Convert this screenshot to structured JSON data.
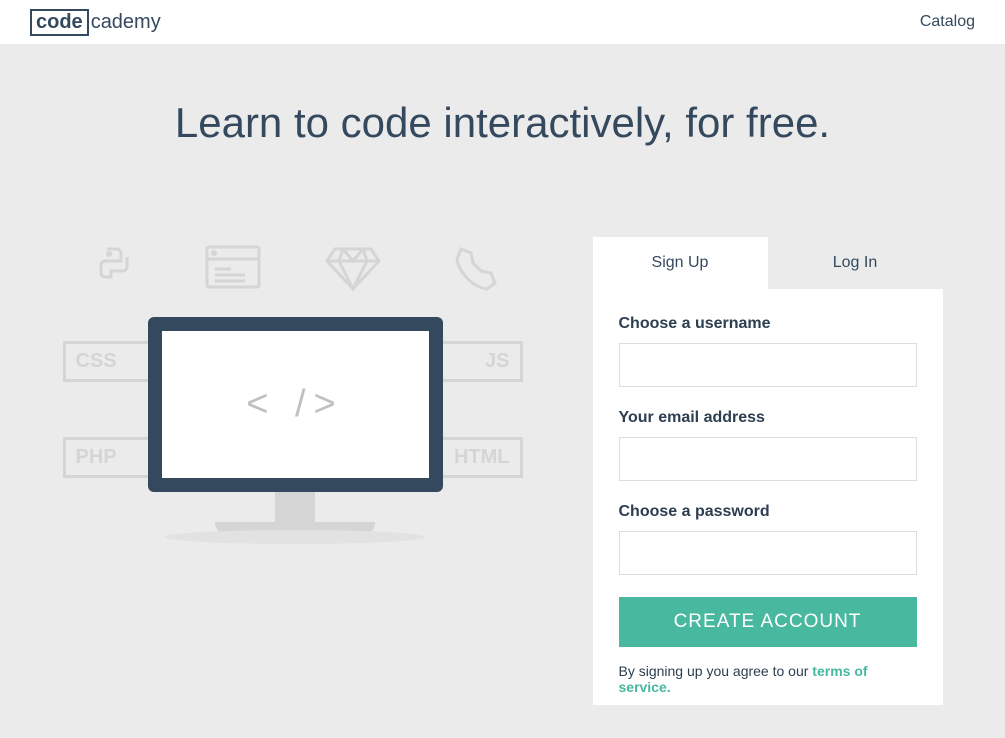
{
  "logo": {
    "boxed": "code",
    "rest": "cademy"
  },
  "nav": {
    "catalog": "Catalog"
  },
  "hero": {
    "headline": "Learn to code interactively, for free."
  },
  "illustration": {
    "tags": {
      "css": "CSS",
      "js": "JS",
      "php": "PHP",
      "html": "HTML"
    },
    "screen_text": "<  />"
  },
  "auth": {
    "tabs": {
      "signup": "Sign Up",
      "login": "Log In"
    },
    "fields": {
      "username_label": "Choose a username",
      "email_label": "Your email address",
      "password_label": "Choose a password"
    },
    "submit": "CREATE ACCOUNT",
    "tos_prefix": "By signing up you agree to our ",
    "tos_link": "terms of service."
  }
}
